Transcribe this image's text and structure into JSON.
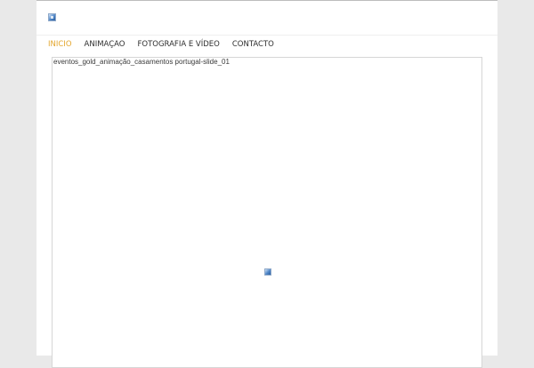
{
  "header": {
    "logo_icon": "broken-image-icon"
  },
  "nav": {
    "items": [
      {
        "label": "INICIO",
        "active": true
      },
      {
        "label": "ANIMAÇAO",
        "active": false
      },
      {
        "label": "FOTOGRAFIA E VÍDEO",
        "active": false
      },
      {
        "label": "CONTACTO",
        "active": false
      }
    ],
    "active_color": "#e4a72f",
    "text_color": "#2f2f2f"
  },
  "slider": {
    "alt_text": "eventos_gold_animação_casamentos portugal-slide_01",
    "image_icon": "broken-image-icon"
  }
}
